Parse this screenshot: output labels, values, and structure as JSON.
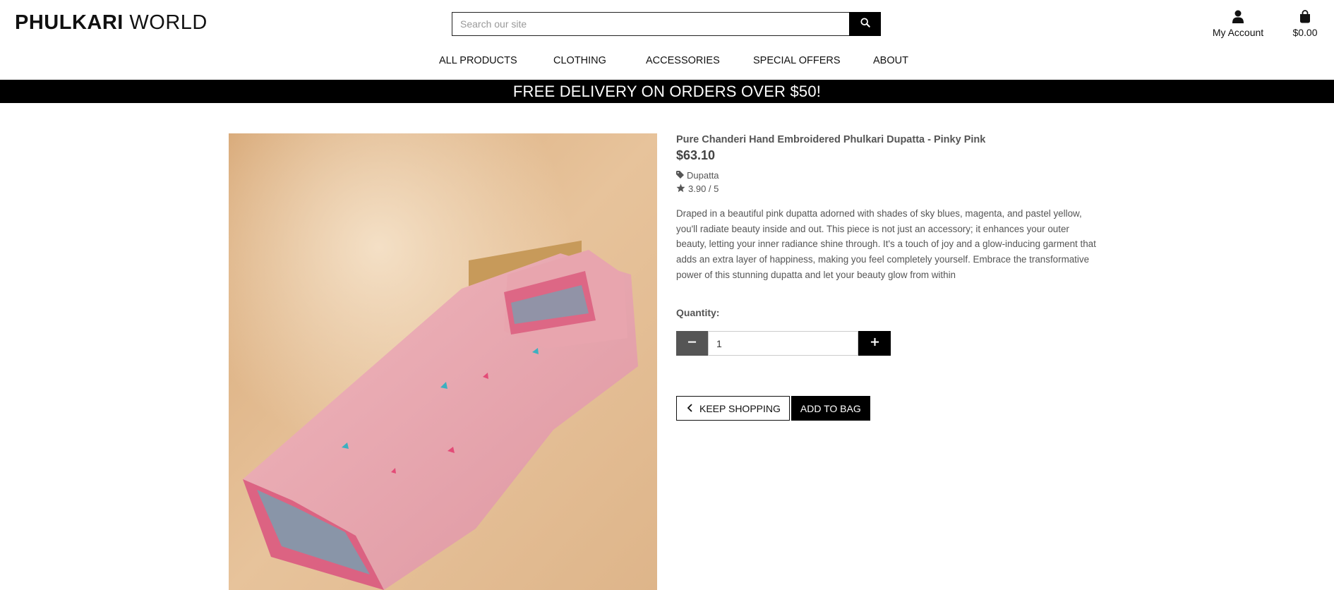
{
  "header": {
    "logo_bold": "PHULKARI",
    "logo_light": " WORLD",
    "search_placeholder": "Search our site",
    "account_label": "My Account",
    "bag_total": "$0.00"
  },
  "nav": {
    "items": [
      "ALL PRODUCTS",
      "CLOTHING",
      "ACCESSORIES",
      "SPECIAL OFFERS",
      "ABOUT"
    ]
  },
  "banner": "FREE DELIVERY ON ORDERS OVER $50!",
  "product": {
    "name": "Pure Chanderi Hand Embroidered Phulkari Dupatta - Pinky Pink",
    "price": "$63.10",
    "category": "Dupatta",
    "rating": "3.90 / 5",
    "description": "Draped in a beautiful pink dupatta adorned with shades of sky blues, magenta, and pastel yellow, you'll radiate beauty inside and out. This piece is not just an accessory; it enhances your outer beauty, letting your inner radiance shine through. It's a touch of joy and a glow-inducing garment that adds an extra layer of happiness, making you feel completely yourself. Embrace the transformative power of this stunning dupatta and let your beauty glow from within"
  },
  "quantity": {
    "label": "Quantity:",
    "value": "1"
  },
  "actions": {
    "keep_shopping": "KEEP SHOPPING",
    "add_to_bag": "ADD TO BAG"
  },
  "colors": {
    "accent": "#000000",
    "muted_button": "#555555",
    "fabric_pink": "#e8a5ae",
    "backdrop": "#e0b98e"
  },
  "icons": [
    "search-icon",
    "user-icon",
    "shopping-bag-icon",
    "tag-icon",
    "star-icon",
    "minus-icon",
    "plus-icon",
    "chevron-left-icon"
  ]
}
